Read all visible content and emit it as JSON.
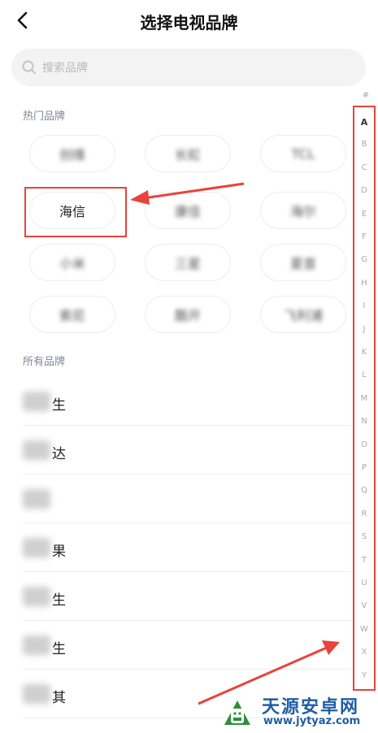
{
  "header": {
    "title": "选择电视品牌"
  },
  "search": {
    "placeholder": "搜索品牌"
  },
  "hot_brands": {
    "label": "热门品牌",
    "items": [
      "创维",
      "长虹",
      "TCL",
      "海信",
      "康佳",
      "海尔",
      "小米",
      "三星",
      "夏普",
      "索尼",
      "酷开",
      "飞利浦"
    ]
  },
  "all_brands": {
    "label": "所有品牌",
    "items": [
      "生",
      "达",
      "",
      "果",
      "生",
      "生",
      "其"
    ]
  },
  "index_bar": {
    "hash": "#",
    "letters": [
      "A",
      "B",
      "C",
      "D",
      "E",
      "F",
      "G",
      "H",
      "I",
      "J",
      "K",
      "L",
      "M",
      "N",
      "O",
      "P",
      "Q",
      "R",
      "S",
      "T",
      "U",
      "V",
      "W",
      "X",
      "Y"
    ]
  },
  "watermark": {
    "name": "天源安卓网",
    "url": "www.jytyaz.com"
  },
  "colors": {
    "annotation_red": "#e8433c",
    "label_gray": "#7d8797",
    "watermark_blue": "#1f5da3"
  }
}
